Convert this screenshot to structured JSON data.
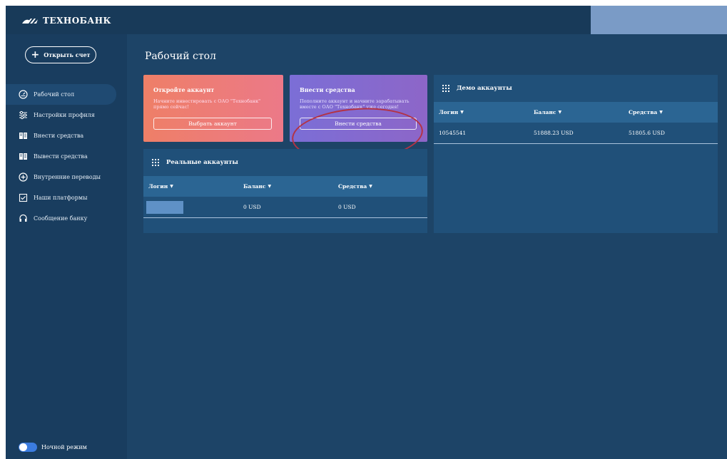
{
  "brand": {
    "name": "ТЕХНОБАНК"
  },
  "sidebar": {
    "open_account": "Открыть счет",
    "items": [
      {
        "label": "Рабочий стол",
        "icon": "dashboard-icon"
      },
      {
        "label": "Настройки профиля",
        "icon": "sliders-icon"
      },
      {
        "label": "Внести средства",
        "icon": "deposit-icon"
      },
      {
        "label": "Вывести средства",
        "icon": "withdraw-icon"
      },
      {
        "label": "Внутренние переводы",
        "icon": "transfer-icon"
      },
      {
        "label": "Наши платформы",
        "icon": "platform-icon"
      },
      {
        "label": "Сообщение банку",
        "icon": "headset-icon"
      }
    ],
    "night_mode": "Ночной режим"
  },
  "main": {
    "title": "Рабочий стол",
    "open_card": {
      "title": "Откройте аккаунт",
      "text": "Начните инвестировать с ОАО \"Технобанк\" прямо сейчас!",
      "button": "Выбрать аккаунт"
    },
    "deposit_card": {
      "title": "Внести средства",
      "text": "Пополните аккаунт и начните зарабатывать вместе с ОАО \"Технобанк\" уже сегодня!",
      "button": "Внести средства"
    },
    "real_accounts": {
      "title": "Реальные аккаунты",
      "columns": [
        "Логин",
        "Баланс",
        "Средства"
      ],
      "rows": [
        {
          "login": "",
          "balance": "0 USD",
          "funds": "0 USD"
        }
      ]
    },
    "demo_accounts": {
      "title": "Демо аккаунты",
      "columns": [
        "Логин",
        "Баланс",
        "Средства"
      ],
      "rows": [
        {
          "login": "10545541",
          "balance": "51888.23 USD",
          "funds": "51805.6 USD"
        }
      ]
    }
  },
  "colors": {
    "background": "#1d4467",
    "sidebar": "#193d5f",
    "orange_card": "#ee7f67",
    "purple_card": "#7b6ed6",
    "highlight_circle": "#b33345"
  }
}
